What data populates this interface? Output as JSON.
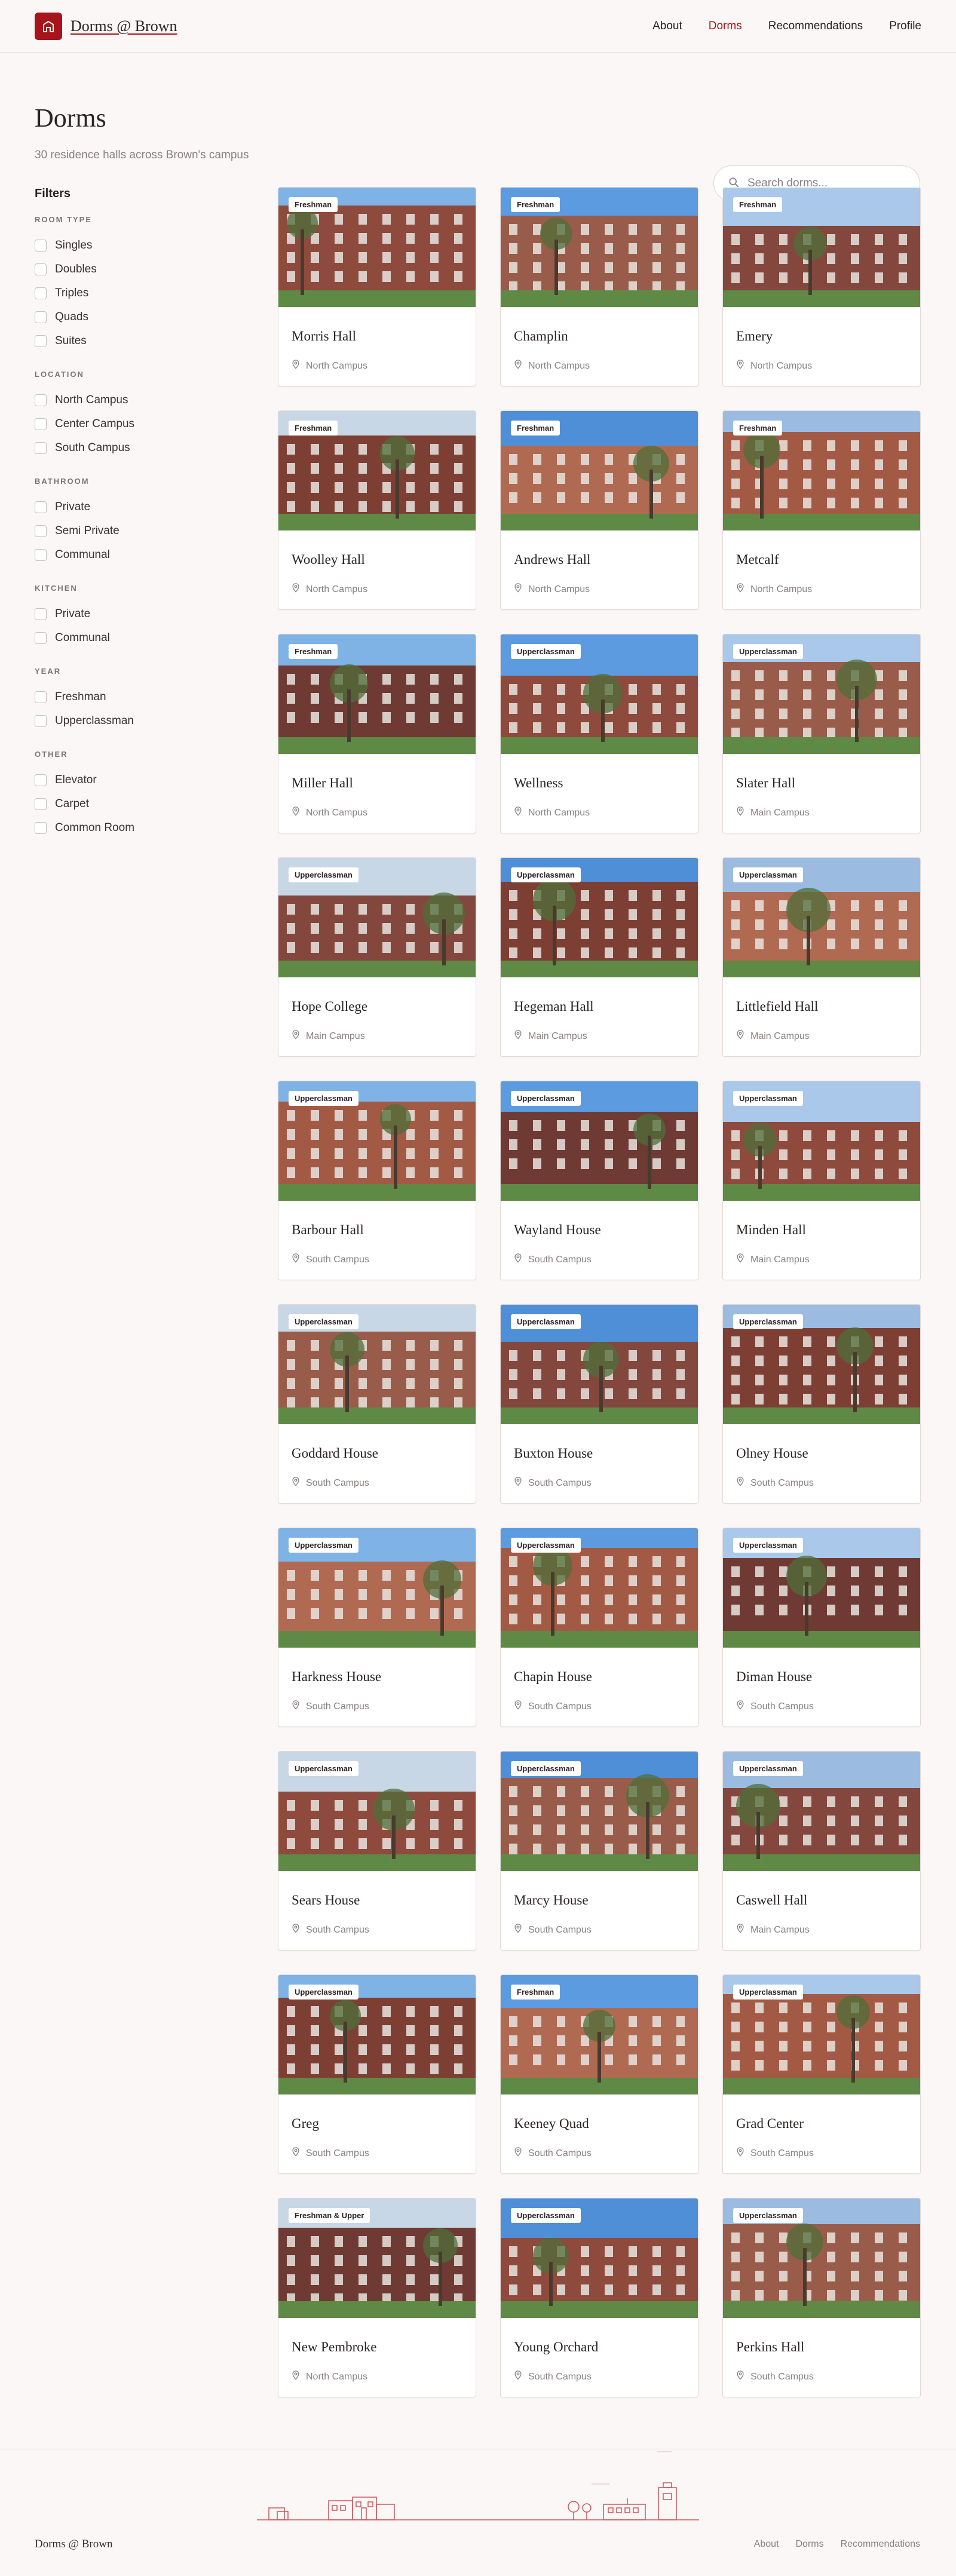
{
  "header": {
    "brand": "Dorms @ Brown",
    "nav": [
      "About",
      "Dorms",
      "Recommendations",
      "Profile"
    ],
    "active": "Dorms"
  },
  "page": {
    "title": "Dorms",
    "subtitle": "30 residence halls across Brown's campus"
  },
  "search": {
    "placeholder": "Search dorms..."
  },
  "filters": {
    "title": "Filters",
    "groups": [
      {
        "label": "ROOM TYPE",
        "options": [
          "Singles",
          "Doubles",
          "Triples",
          "Quads",
          "Suites"
        ]
      },
      {
        "label": "LOCATION",
        "options": [
          "North Campus",
          "Center Campus",
          "South Campus"
        ]
      },
      {
        "label": "BATHROOM",
        "options": [
          "Private",
          "Semi Private",
          "Communal"
        ]
      },
      {
        "label": "KITCHEN",
        "options": [
          "Private",
          "Communal"
        ]
      },
      {
        "label": "YEAR",
        "options": [
          "Freshman",
          "Upperclassman"
        ]
      },
      {
        "label": "OTHER",
        "options": [
          "Elevator",
          "Carpet",
          "Common Room"
        ]
      }
    ]
  },
  "dorms": [
    {
      "name": "Morris Hall",
      "badge": "Freshman",
      "location": "North Campus"
    },
    {
      "name": "Champlin",
      "badge": "Freshman",
      "location": "North Campus"
    },
    {
      "name": "Emery",
      "badge": "Freshman",
      "location": "North Campus"
    },
    {
      "name": "Woolley Hall",
      "badge": "Freshman",
      "location": "North Campus"
    },
    {
      "name": "Andrews Hall",
      "badge": "Freshman",
      "location": "North Campus"
    },
    {
      "name": "Metcalf",
      "badge": "Freshman",
      "location": "North Campus"
    },
    {
      "name": "Miller Hall",
      "badge": "Freshman",
      "location": "North Campus"
    },
    {
      "name": "Wellness",
      "badge": "Upperclassman",
      "location": "North Campus"
    },
    {
      "name": "Slater Hall",
      "badge": "Upperclassman",
      "location": "Main Campus"
    },
    {
      "name": "Hope College",
      "badge": "Upperclassman",
      "location": "Main Campus"
    },
    {
      "name": "Hegeman Hall",
      "badge": "Upperclassman",
      "location": "Main Campus"
    },
    {
      "name": "Littlefield Hall",
      "badge": "Upperclassman",
      "location": "Main Campus"
    },
    {
      "name": "Barbour Hall",
      "badge": "Upperclassman",
      "location": "South Campus"
    },
    {
      "name": "Wayland House",
      "badge": "Upperclassman",
      "location": "South Campus"
    },
    {
      "name": "Minden Hall",
      "badge": "Upperclassman",
      "location": "Main Campus"
    },
    {
      "name": "Goddard House",
      "badge": "Upperclassman",
      "location": "South Campus"
    },
    {
      "name": "Buxton House",
      "badge": "Upperclassman",
      "location": "South Campus"
    },
    {
      "name": "Olney House",
      "badge": "Upperclassman",
      "location": "South Campus"
    },
    {
      "name": "Harkness House",
      "badge": "Upperclassman",
      "location": "South Campus"
    },
    {
      "name": "Chapin House",
      "badge": "Upperclassman",
      "location": "South Campus"
    },
    {
      "name": "Diman House",
      "badge": "Upperclassman",
      "location": "South Campus"
    },
    {
      "name": "Sears House",
      "badge": "Upperclassman",
      "location": "South Campus"
    },
    {
      "name": "Marcy House",
      "badge": "Upperclassman",
      "location": "South Campus"
    },
    {
      "name": "Caswell Hall",
      "badge": "Upperclassman",
      "location": "Main Campus"
    },
    {
      "name": "Greg",
      "badge": "Upperclassman",
      "location": "South Campus"
    },
    {
      "name": "Keeney Quad",
      "badge": "Freshman",
      "location": "South Campus"
    },
    {
      "name": "Grad Center",
      "badge": "Upperclassman",
      "location": "South Campus"
    },
    {
      "name": "New Pembroke",
      "badge": "Freshman & Upper",
      "location": "North Campus"
    },
    {
      "name": "Young Orchard",
      "badge": "Upperclassman",
      "location": "South Campus"
    },
    {
      "name": "Perkins Hall",
      "badge": "Upperclassman",
      "location": "South Campus"
    }
  ],
  "footer": {
    "brand": "Dorms @ Brown",
    "links": [
      "About",
      "Dorms",
      "Recommendations"
    ]
  },
  "colors": {
    "accent": "#a8141b",
    "background": "#faf7f6"
  },
  "icons": {
    "logo": "building-icon",
    "search": "search-icon",
    "location": "map-pin-icon"
  }
}
